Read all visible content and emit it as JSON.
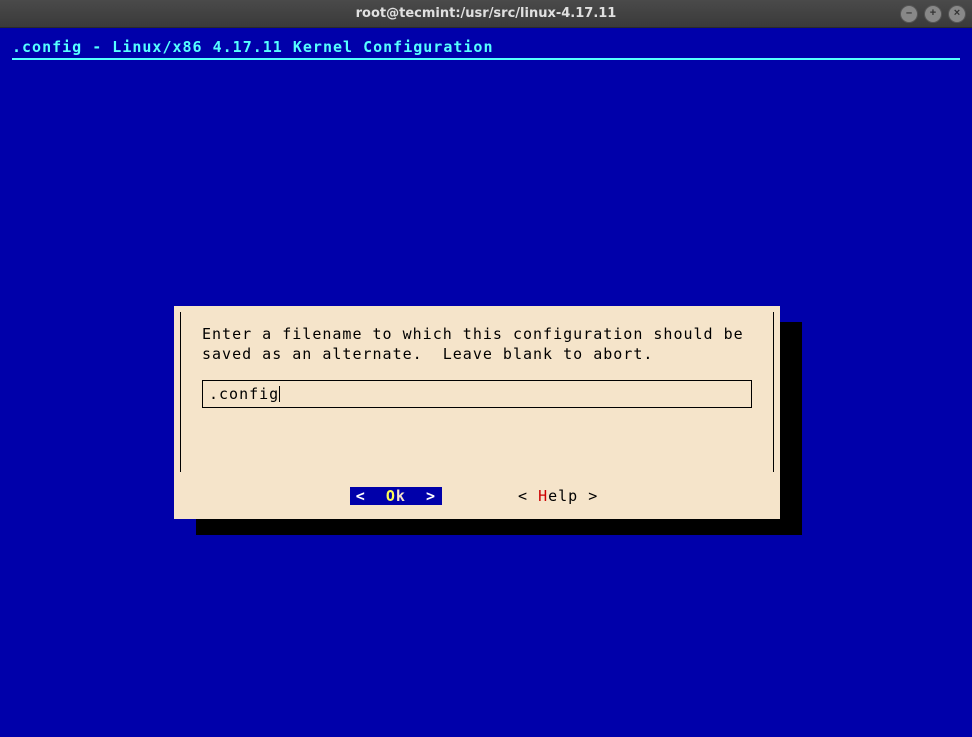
{
  "window": {
    "title": "root@tecmint:/usr/src/linux-4.17.11"
  },
  "terminal": {
    "heading": ".config - Linux/x86 4.17.11 Kernel Configuration"
  },
  "dialog": {
    "message": "Enter a filename to which this configuration should be saved as an alternate.  Leave blank to abort.",
    "input_value": ".config",
    "buttons": {
      "ok": {
        "bracket_l": "<",
        "hot": "O",
        "rest": "k",
        "bracket_r": ">"
      },
      "help": {
        "bracket_l": "<",
        "hot": "H",
        "rest": "elp",
        "bracket_r": ">"
      }
    }
  }
}
